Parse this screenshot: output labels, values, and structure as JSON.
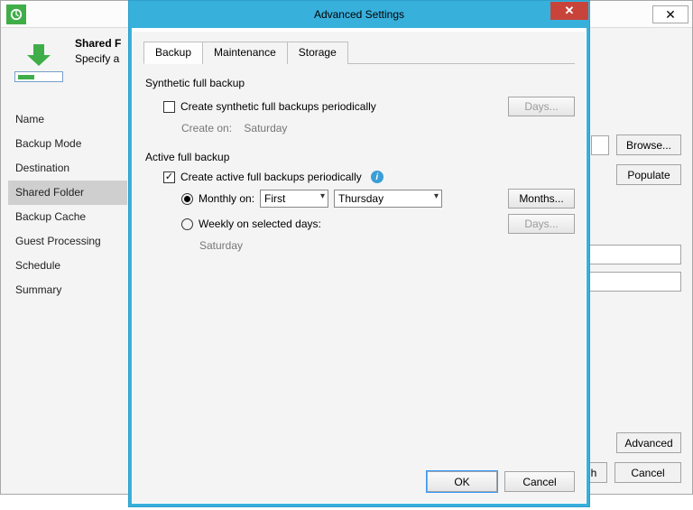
{
  "wizard": {
    "header_title": "Shared F",
    "header_sub": "Specify a",
    "nav": [
      "Name",
      "Backup Mode",
      "Destination",
      "Shared Folder",
      "Backup Cache",
      "Guest Processing",
      "Schedule",
      "Summary"
    ],
    "nav_selected": 3,
    "browse_btn": "Browse...",
    "populate_btn": "Populate",
    "advanced_btn": "Advanced",
    "cancel_btn": "Cancel",
    "trailing_h": "h"
  },
  "modal": {
    "title": "Advanced Settings",
    "tabs": [
      "Backup",
      "Maintenance",
      "Storage"
    ],
    "active_tab": 0,
    "synthetic": {
      "group": "Synthetic full backup",
      "chk_label": "Create synthetic full backups periodically",
      "checked": false,
      "create_on_label": "Create on:",
      "create_on_value": "Saturday",
      "days_btn": "Days..."
    },
    "active": {
      "group": "Active full backup",
      "chk_label": "Create active full backups periodically",
      "checked": true,
      "monthly_label": "Monthly on:",
      "monthly_sel1": "First",
      "monthly_sel2": "Thursday",
      "months_btn": "Months...",
      "weekly_label": "Weekly on selected days:",
      "weekly_days_btn": "Days...",
      "weekly_value": "Saturday",
      "radio_selected": "monthly"
    },
    "ok": "OK",
    "cancel": "Cancel"
  }
}
